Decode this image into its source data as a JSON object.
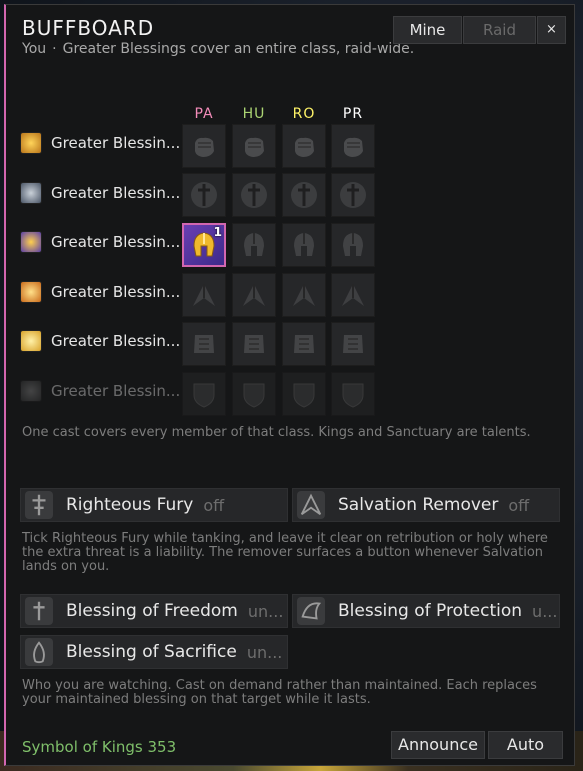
{
  "header": {
    "title": "BUFFBOARD",
    "subtitle_scope": "You",
    "subtitle_separator": "·",
    "subtitle_text": "Greater Blessings cover an entire class, raid-wide.",
    "mine_label": "Mine",
    "raid_label": "Raid",
    "close_label": "×"
  },
  "grid": {
    "columns": [
      {
        "label": "PA",
        "color": "#f48cba"
      },
      {
        "label": "HU",
        "color": "#abd473"
      },
      {
        "label": "RO",
        "color": "#fff468"
      },
      {
        "label": "PR",
        "color": "#ffffff"
      }
    ],
    "rows": [
      {
        "label": "Greater Blessin...",
        "icon": "fist-icon"
      },
      {
        "label": "Greater Blessin...",
        "icon": "sword-icon"
      },
      {
        "label": "Greater Blessin...",
        "icon": "helmet-icon"
      },
      {
        "label": "Greater Blessin...",
        "icon": "wings-icon"
      },
      {
        "label": "Greater Blessin...",
        "icon": "armor-icon"
      },
      {
        "label": "Greater Blessin...",
        "icon": "shield-icon"
      }
    ],
    "active_cell": {
      "row": 3,
      "col": 1,
      "count": "1"
    },
    "note": "One cast covers every member of that class. Kings and Sanctuary are talents."
  },
  "toggles": {
    "righteous_fury": {
      "label": "Righteous Fury",
      "state": "off"
    },
    "salvation_remover": {
      "label": "Salvation Remover",
      "state": "off"
    },
    "note": "Tick Righteous Fury while tanking, and leave it clear on retribution or holy where the extra threat is a liability. The remover surfaces a button whenever Salvation lands on you."
  },
  "hand_blessings": {
    "freedom": {
      "label": "Blessing of Freedom",
      "state": "un..."
    },
    "protection": {
      "label": "Blessing of Protection",
      "state": "u..."
    },
    "sacrifice": {
      "label": "Blessing of Sacrifice",
      "state": "un..."
    },
    "note": "Who you are watching. Cast on demand rather than maintained. Each replaces your maintained blessing on that target while it lasts."
  },
  "footer": {
    "reagent_text": "Symbol of Kings 353",
    "announce_label": "Announce",
    "auto_label": "Auto"
  }
}
